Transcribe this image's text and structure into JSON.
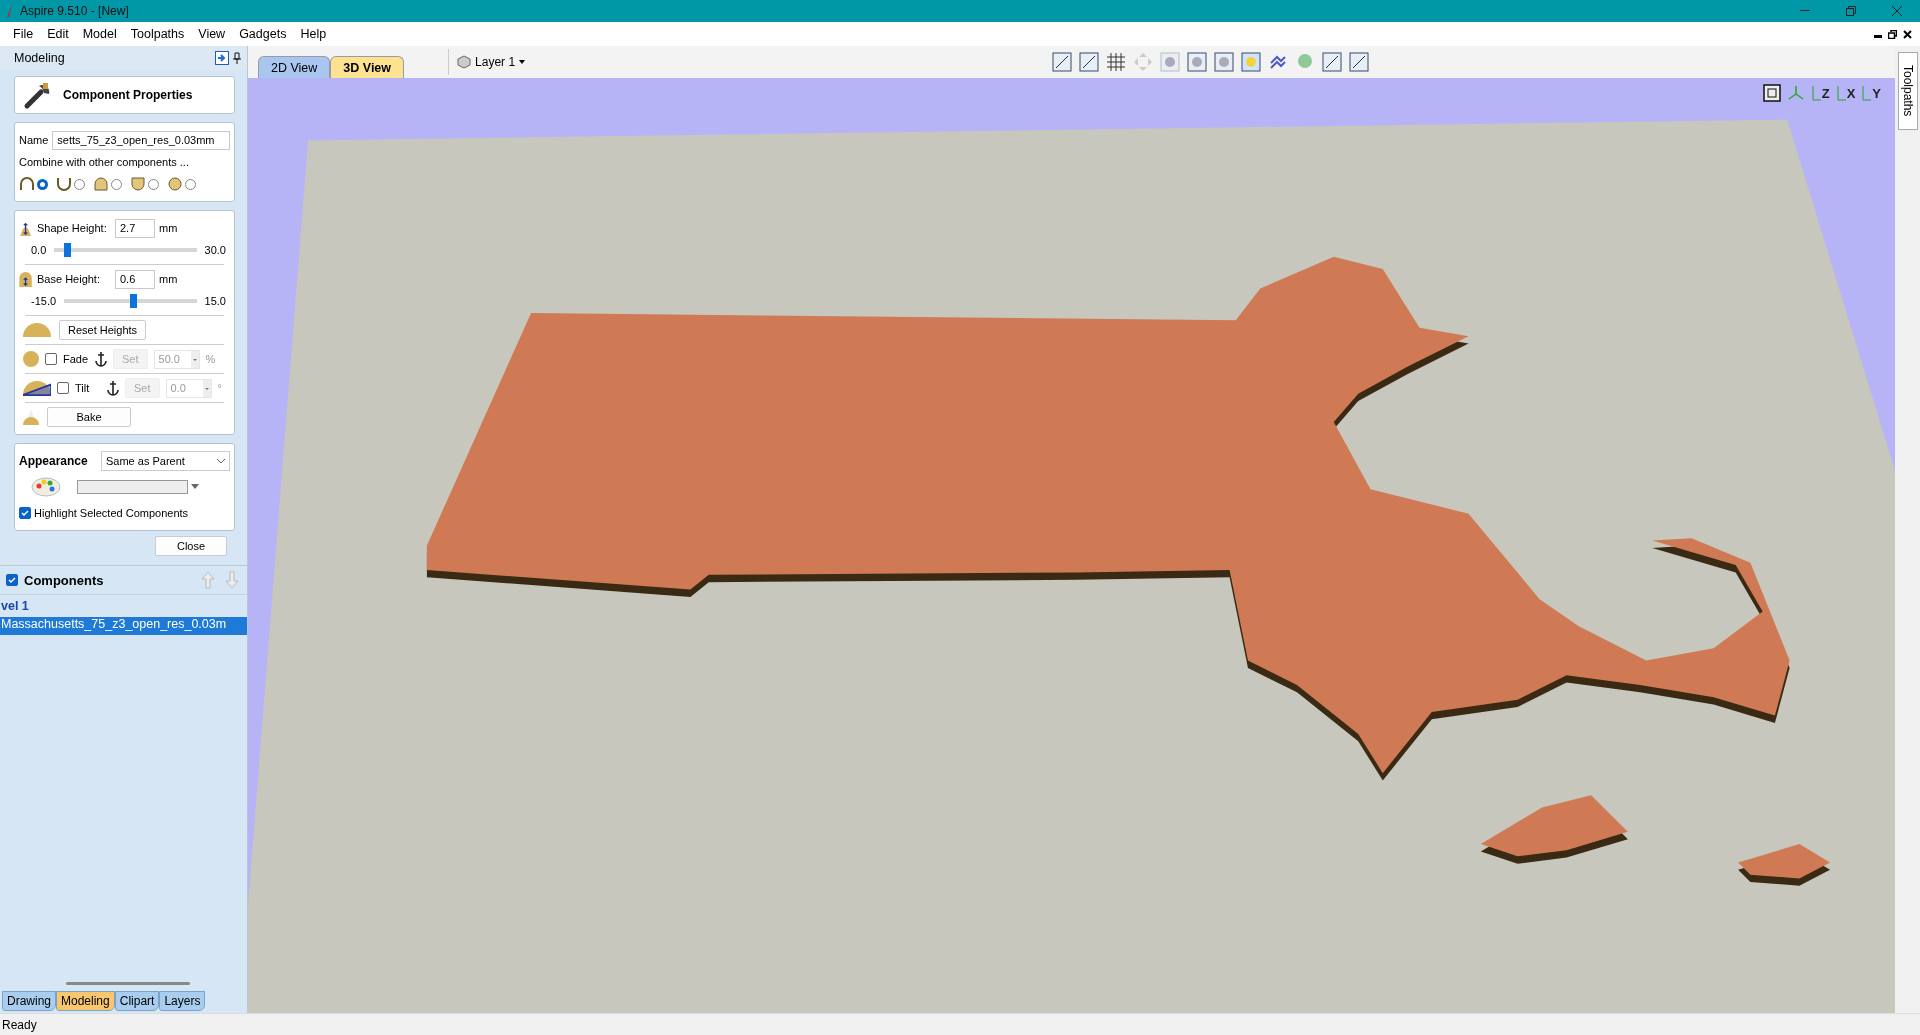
{
  "window": {
    "title": "Aspire 9.510 - [New]"
  },
  "menu": [
    "File",
    "Edit",
    "Model",
    "Toolpaths",
    "View",
    "Gadgets",
    "Help"
  ],
  "panel": {
    "title": "Modeling"
  },
  "component_properties": {
    "title": "Component Properties",
    "name_label": "Name",
    "name_value": "setts_75_z3_open_res_0.03mm",
    "combine_label": "Combine with other components ...",
    "combine_modes": [
      {
        "kind": "add",
        "selected": true
      },
      {
        "kind": "subtract",
        "selected": false
      },
      {
        "kind": "merge",
        "selected": false
      },
      {
        "kind": "low",
        "selected": false
      },
      {
        "kind": "multiply",
        "selected": false
      }
    ],
    "heights": [
      {
        "kind": "shape",
        "label": "Shape Height:",
        "value": "2.7",
        "unit": "mm",
        "min": "0.0",
        "max": "30.0",
        "level": 0.09
      },
      {
        "kind": "base",
        "label": "Base Height:",
        "value": "0.6",
        "unit": "mm",
        "min": "-15.0",
        "max": "15.0",
        "level": 0.52
      }
    ],
    "reset_button": "Reset Heights",
    "modifiers": [
      {
        "kind": "fade",
        "label": "Fade",
        "checked": false,
        "set": "Set",
        "disabled": true,
        "value": "50.0",
        "unit": "%"
      },
      {
        "kind": "tilt",
        "label": "Tilt",
        "checked": false,
        "set": "Set",
        "disabled": true,
        "value": "0.0",
        "unit": "°"
      }
    ],
    "bake_button": "Bake",
    "appearance": {
      "label": "Appearance",
      "value": "Same as Parent",
      "highlight_label": "Highlight Selected Components",
      "highlight_checked": true
    },
    "close_button": "Close"
  },
  "components": {
    "title": "Components",
    "checked": true,
    "tree": [
      {
        "label": "vel 1",
        "selected": false,
        "children": [
          {
            "label": "Massachusetts_75_z3_open_res_0.03m",
            "selected": true
          }
        ]
      }
    ]
  },
  "bottom_tabs": [
    {
      "label": "Drawing",
      "selected": false
    },
    {
      "label": "Modeling",
      "selected": true
    },
    {
      "label": "Clipart",
      "selected": false
    },
    {
      "label": "Layers",
      "selected": false
    }
  ],
  "view_tabs": [
    {
      "label": "2D View",
      "selected": false
    },
    {
      "label": "3D View",
      "selected": true
    }
  ],
  "layer": "Layer 1",
  "view_axes": [
    "Z",
    "X",
    "Y"
  ],
  "side_tab": "Toolpaths",
  "status": "Ready"
}
